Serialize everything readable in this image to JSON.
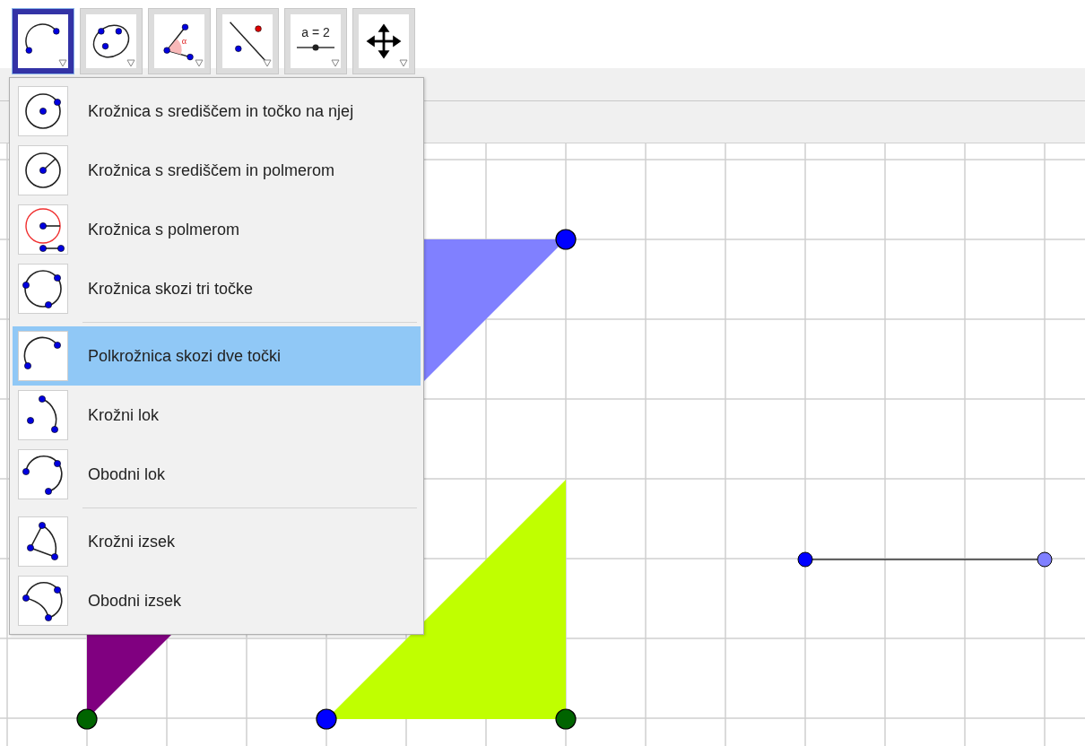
{
  "toolbar": {
    "tools": [
      {
        "kind": "semicircle",
        "selected": true
      },
      {
        "kind": "ellipse",
        "selected": false
      },
      {
        "kind": "angle",
        "label": "α",
        "selected": false
      },
      {
        "kind": "line-point",
        "selected": false
      },
      {
        "kind": "slider",
        "label": "a = 2",
        "selected": false
      },
      {
        "kind": "move",
        "selected": false
      }
    ]
  },
  "menu": {
    "groups": [
      [
        {
          "kind": "circle-center-point",
          "label": "Krožnica s središčem in točko na njej",
          "selected": false
        },
        {
          "kind": "circle-center-radius",
          "label": "Krožnica s središčem in polmerom",
          "selected": false
        },
        {
          "kind": "circle-radius",
          "label": "Krožnica s polmerom",
          "selected": false
        },
        {
          "kind": "circle-three",
          "label": "Krožnica skozi tri točke",
          "selected": false
        }
      ],
      [
        {
          "kind": "semicircle",
          "label": "Polkrožnica skozi dve točki",
          "selected": true
        },
        {
          "kind": "arc-center",
          "label": "Krožni lok",
          "selected": false
        },
        {
          "kind": "arc-three",
          "label": "Obodni lok",
          "selected": false
        }
      ],
      [
        {
          "kind": "sector-center",
          "label": "Krožni izsek",
          "selected": false
        },
        {
          "kind": "sector-three",
          "label": "Obodni izsek",
          "selected": false
        }
      ]
    ]
  }
}
